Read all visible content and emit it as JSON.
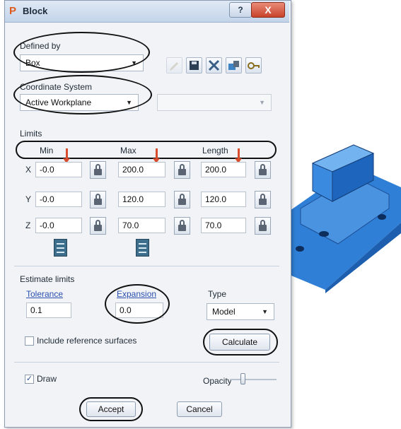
{
  "window": {
    "title": "Block",
    "app_icon": "P",
    "help_glyph": "?",
    "close_glyph": "X"
  },
  "defined_by": {
    "label": "Defined by",
    "value": "Box"
  },
  "toolbar": {
    "icons": [
      "edit-icon",
      "save-icon",
      "select-icon",
      "import-icon",
      "lock-key-icon"
    ]
  },
  "coordinate_system": {
    "label": "Coordinate System",
    "value": "Active Workplane",
    "second_value": ""
  },
  "limits": {
    "label": "Limits",
    "headers": [
      "Min",
      "Max",
      "Length"
    ],
    "rows": [
      {
        "axis": "X",
        "min": "-0.0",
        "max": "200.0",
        "length": "200.0"
      },
      {
        "axis": "Y",
        "min": "-0.0",
        "max": "120.0",
        "length": "120.0"
      },
      {
        "axis": "Z",
        "min": "-0.0",
        "max": "70.0",
        "length": "70.0"
      }
    ]
  },
  "estimate_limits": {
    "label": "Estimate limits",
    "tolerance_label": "Tolerance",
    "tolerance_value": "0.1",
    "expansion_label": "Expansion",
    "expansion_value": "0.0",
    "type_label": "Type",
    "type_value": "Model",
    "include_ref_label": "Include reference surfaces",
    "include_ref_checked": false,
    "calculate_label": "Calculate"
  },
  "draw": {
    "label": "Draw",
    "checked": true,
    "check_glyph": "✓"
  },
  "opacity": {
    "label": "Opacity",
    "level_fraction": 0.25
  },
  "buttons": {
    "accept": "Accept",
    "cancel": "Cancel"
  },
  "colors": {
    "accent_blue": "#2a7fd4",
    "annotation_red": "#d94d2f",
    "annotation_black": "#111111"
  }
}
